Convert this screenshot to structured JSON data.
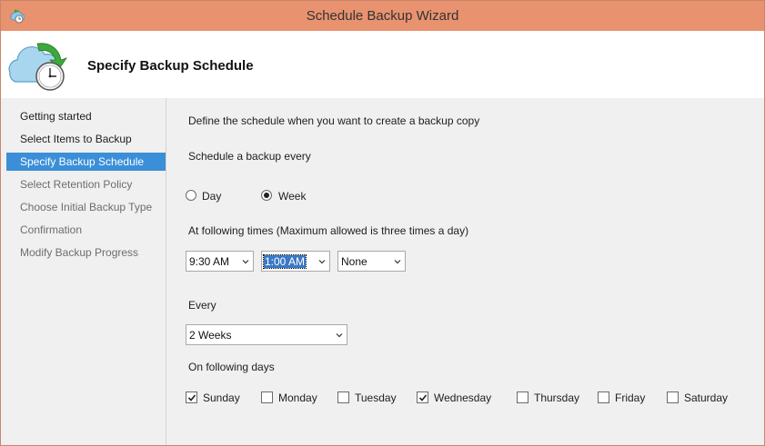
{
  "window": {
    "title": "Schedule Backup Wizard"
  },
  "header": {
    "title": "Specify Backup Schedule",
    "icon": "backup-clock-icon"
  },
  "nav": {
    "items": [
      {
        "label": "Getting started",
        "state": "done"
      },
      {
        "label": "Select Items to Backup",
        "state": "done"
      },
      {
        "label": "Specify Backup Schedule",
        "state": "active"
      },
      {
        "label": "Select Retention Policy",
        "state": "disabled"
      },
      {
        "label": "Choose Initial Backup Type",
        "state": "disabled"
      },
      {
        "label": "Confirmation",
        "state": "disabled"
      },
      {
        "label": "Modify Backup Progress",
        "state": "disabled"
      }
    ]
  },
  "main": {
    "intro": "Define the schedule when you want to create a backup copy",
    "frequency_label": "Schedule a backup every",
    "frequency": {
      "options": [
        {
          "label": "Day",
          "checked": false
        },
        {
          "label": "Week",
          "checked": true
        }
      ]
    },
    "times_label": "At following times (Maximum allowed is three times a day)",
    "times": [
      {
        "value": "9:30 AM"
      },
      {
        "value": "1:00 AM",
        "focused": true
      },
      {
        "value": "None"
      }
    ],
    "every_label": "Every",
    "every_value": "2 Weeks",
    "days_label": "On following days",
    "days": [
      {
        "label": "Sunday",
        "checked": true
      },
      {
        "label": "Monday",
        "checked": false
      },
      {
        "label": "Tuesday",
        "checked": false
      },
      {
        "label": "Wednesday",
        "checked": true
      },
      {
        "label": "Thursday",
        "checked": false
      },
      {
        "label": "Friday",
        "checked": false
      },
      {
        "label": "Saturday",
        "checked": false
      }
    ]
  },
  "colors": {
    "titlebar": "#e8926f",
    "nav_active": "#3b8fd8",
    "panel_bg": "#f0f0f0"
  }
}
